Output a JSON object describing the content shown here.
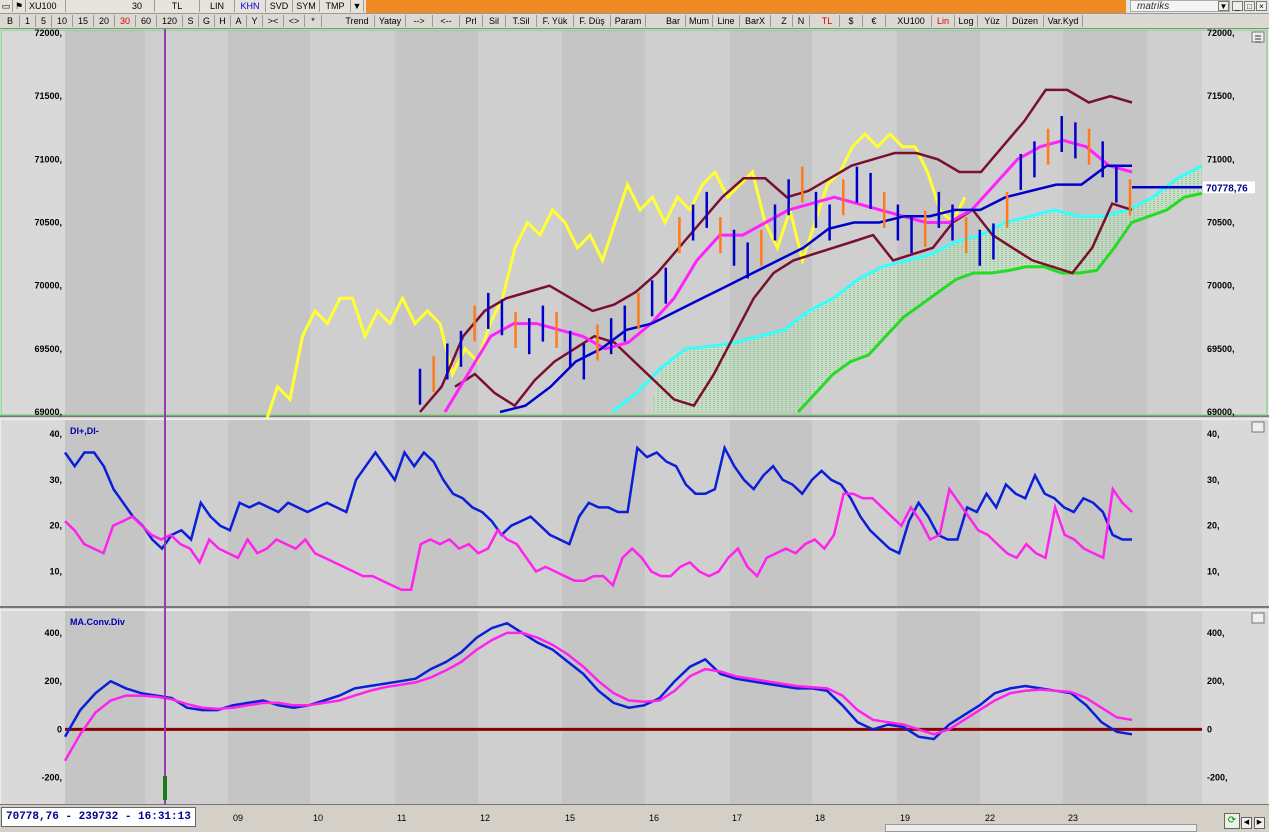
{
  "titlebar": {
    "tabs": [
      "XU100",
      "30",
      "TL",
      "LIN",
      "KHN",
      "SVD",
      "SYM",
      "TMP",
      "▼"
    ],
    "logo": "matriks",
    "window_controls": [
      "▼",
      "_",
      "□",
      "×"
    ]
  },
  "toolbar": {
    "buttons": [
      "B",
      "1",
      "5",
      "10",
      "15",
      "20",
      "30",
      "60",
      "120",
      "S",
      "G",
      "H",
      "A",
      "Y",
      "><",
      "<>",
      "*",
      "Trend",
      "Yatay",
      "-->",
      "<--",
      "Prl",
      "Sil",
      "T.Sil",
      "F. Yük",
      "F. Düş",
      "Param",
      "Bar",
      "Mum",
      "Line",
      "BarX",
      "Z",
      "N",
      "TL",
      "$",
      "€",
      "XU100",
      "Lin",
      "Log",
      "Yüz",
      "Düzen",
      "Var.Kyd"
    ],
    "active_period": "30",
    "active_scale": "Lin"
  },
  "price_panel": {
    "y_ticks": [
      "72000,",
      "71500,",
      "71000,",
      "70500,",
      "70000,",
      "69500,",
      "69000,"
    ],
    "last_price_tag": "70778,76"
  },
  "dmi_panel": {
    "label": "DI+,DI-",
    "y_ticks": [
      "40,",
      "30,",
      "20,",
      "10,"
    ]
  },
  "macd_panel": {
    "label": "MA.Conv.Div",
    "y_ticks": [
      "400,",
      "200,",
      "0",
      "-200,"
    ]
  },
  "status": {
    "readout": "70778,76 - 239732 - 16:31:13",
    "x_dates": [
      "09",
      "10",
      "11",
      "12",
      "15",
      "16",
      "17",
      "18",
      "19",
      "22",
      "23"
    ]
  },
  "chart_data": [
    {
      "type": "line",
      "panel": "price",
      "ylim": [
        69000,
        72000
      ],
      "y_ticks": [
        72000,
        71500,
        71000,
        70500,
        70000,
        69500,
        69000
      ],
      "x": [
        "09",
        "10",
        "11",
        "12",
        "15",
        "16",
        "17",
        "18",
        "19",
        "22",
        "23"
      ],
      "last_price": 70778.76,
      "series": [],
      "colors": {
        "yellow": "#ffff33",
        "magenta": "#ff22ff",
        "blue": "#0000cc",
        "maroon": "#7a1030",
        "cyan": "#33ffff",
        "green": "#22dd22",
        "bar_up": "#0000cc",
        "bar_down": "#ff7a1a"
      }
    },
    {
      "type": "line",
      "panel": "dmi",
      "title": "DI+,DI-",
      "ylim": [
        4,
        42
      ],
      "y_ticks": [
        40,
        30,
        20,
        10
      ],
      "series": [
        {
          "color": "#0a1fd8",
          "values": [
            36,
            33,
            36,
            36,
            33,
            28,
            25,
            22,
            20,
            17,
            15,
            18,
            19,
            17,
            25,
            22,
            20,
            19,
            25,
            24,
            25,
            24,
            23,
            25,
            24,
            23,
            24,
            25,
            24,
            23,
            30,
            33,
            36,
            33,
            30,
            36,
            33,
            36,
            34,
            30,
            27,
            26,
            24,
            23,
            21,
            18,
            20,
            21,
            22,
            20,
            18,
            17,
            16,
            22,
            25,
            24,
            24,
            23,
            23,
            37,
            35,
            36,
            34,
            33,
            29,
            27,
            27,
            28,
            37,
            33,
            30,
            28,
            31,
            33,
            30,
            29,
            27,
            30,
            32,
            30,
            29,
            26,
            22,
            19,
            17,
            15,
            14,
            21,
            25,
            22,
            18,
            17,
            17,
            24,
            23,
            27,
            24,
            29,
            27,
            26,
            31,
            27,
            26,
            24,
            23,
            26,
            25,
            23,
            18,
            17,
            17
          ]
        },
        {
          "color": "#ff22ee",
          "values": [
            21,
            19,
            16,
            15,
            14,
            20,
            21,
            22,
            20,
            18,
            17,
            18,
            16,
            15,
            12,
            17,
            15,
            14,
            13,
            17,
            14,
            15,
            17,
            16,
            15,
            17,
            14,
            13,
            12,
            11,
            10,
            9,
            9,
            8,
            7,
            6,
            6,
            16,
            17,
            16,
            17,
            15,
            16,
            14,
            15,
            19,
            17,
            16,
            13,
            10,
            11,
            10,
            9,
            8,
            8,
            9,
            9,
            7,
            13,
            15,
            13,
            10,
            9,
            9,
            11,
            12,
            10,
            9,
            10,
            13,
            15,
            11,
            9,
            13,
            14,
            15,
            14,
            16,
            17,
            15,
            18,
            27,
            27,
            26,
            26,
            24,
            22,
            20,
            24,
            21,
            17,
            18,
            28,
            25,
            22,
            19,
            18,
            16,
            14,
            13,
            16,
            14,
            13,
            24,
            18,
            17,
            15,
            14,
            13,
            28,
            25,
            23
          ]
        }
      ]
    },
    {
      "type": "line",
      "panel": "macd",
      "title": "MA.Conv.Div",
      "ylim": [
        -280,
        470
      ],
      "y_ticks": [
        400,
        200,
        0,
        -200
      ],
      "series": [
        {
          "color": "#0a1fd8",
          "values": [
            -30,
            80,
            150,
            200,
            170,
            150,
            140,
            130,
            90,
            80,
            80,
            100,
            110,
            120,
            100,
            90,
            100,
            120,
            140,
            170,
            180,
            190,
            200,
            210,
            250,
            280,
            320,
            380,
            420,
            440,
            400,
            360,
            330,
            280,
            230,
            160,
            110,
            90,
            100,
            130,
            200,
            260,
            290,
            230,
            210,
            200,
            190,
            180,
            170,
            170,
            160,
            100,
            30,
            0,
            20,
            10,
            -30,
            -40,
            20,
            60,
            100,
            150,
            170,
            180,
            170,
            160,
            150,
            100,
            30,
            -10,
            -20
          ]
        },
        {
          "color": "#ff22ee",
          "values": [
            -130,
            -20,
            70,
            120,
            140,
            140,
            135,
            125,
            105,
            90,
            85,
            90,
            100,
            110,
            110,
            100,
            100,
            110,
            120,
            140,
            160,
            175,
            185,
            195,
            215,
            245,
            280,
            330,
            370,
            400,
            400,
            380,
            350,
            310,
            260,
            200,
            150,
            120,
            115,
            120,
            160,
            220,
            250,
            240,
            220,
            210,
            200,
            190,
            180,
            175,
            170,
            140,
            80,
            40,
            30,
            20,
            0,
            -20,
            0,
            40,
            80,
            120,
            150,
            160,
            165,
            160,
            155,
            130,
            90,
            50,
            40
          ]
        }
      ],
      "zero_line_color": "#8b0000"
    }
  ]
}
